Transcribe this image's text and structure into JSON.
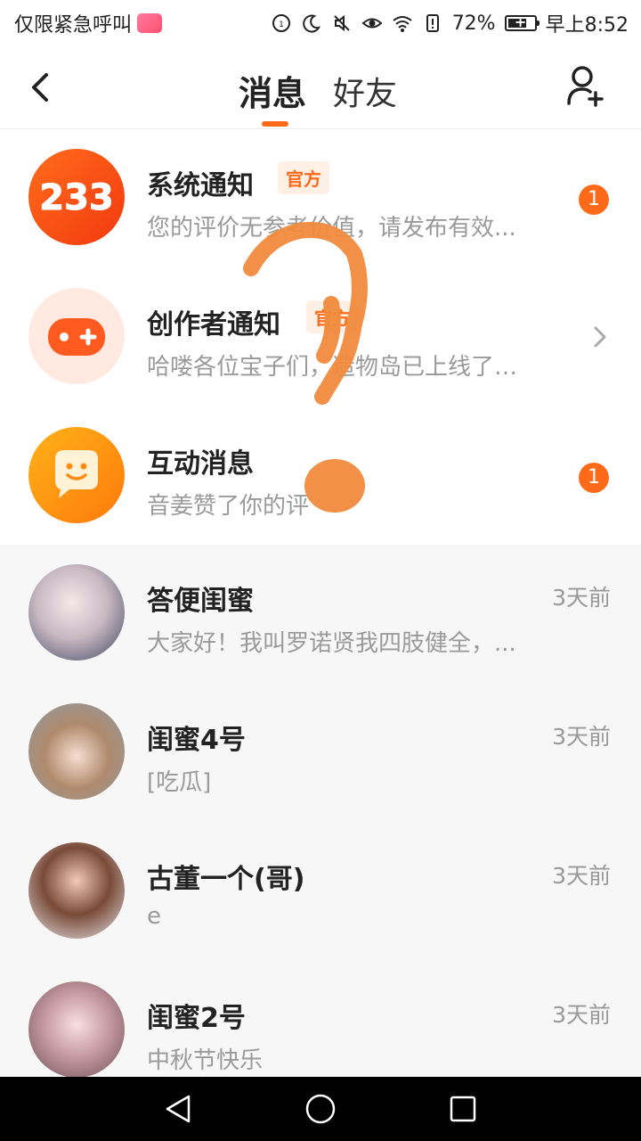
{
  "status": {
    "carrier": "仅限紧急呼叫",
    "battery": "72%",
    "time": "早上8:52",
    "battery_level": 0.72
  },
  "header": {
    "back_icon": "back-arrow-icon",
    "tab_messages": "消息",
    "tab_friends": "好友",
    "add_icon": "add-friend-icon",
    "accent": "#ff6a1a"
  },
  "notices": [
    {
      "title": "系统通知",
      "tag": "官方",
      "subtitle": "您的评价无参考价值，请发布有效...",
      "badge": "1",
      "icon": "233-logo-icon"
    },
    {
      "title": "创作者通知",
      "tag": "官方",
      "subtitle": "哈喽各位宝子们，造物岛已上线了道...",
      "icon": "gamepad-icon"
    },
    {
      "title": "互动消息",
      "subtitle": "音姜赞了你的评",
      "badge": "1",
      "icon": "chat-bubble-icon"
    }
  ],
  "friends": [
    {
      "name": "答便闺蜜",
      "preview": "大家好！我叫罗诺贤我四肢健全，...",
      "time": "3天前"
    },
    {
      "name": "闺蜜4号",
      "preview": "[吃瓜]",
      "time": "3天前"
    },
    {
      "name": "古董一个(哥)",
      "preview": "e",
      "time": "3天前"
    },
    {
      "name": "闺蜜2号",
      "preview": "中秋节快乐",
      "time": "3天前"
    }
  ]
}
